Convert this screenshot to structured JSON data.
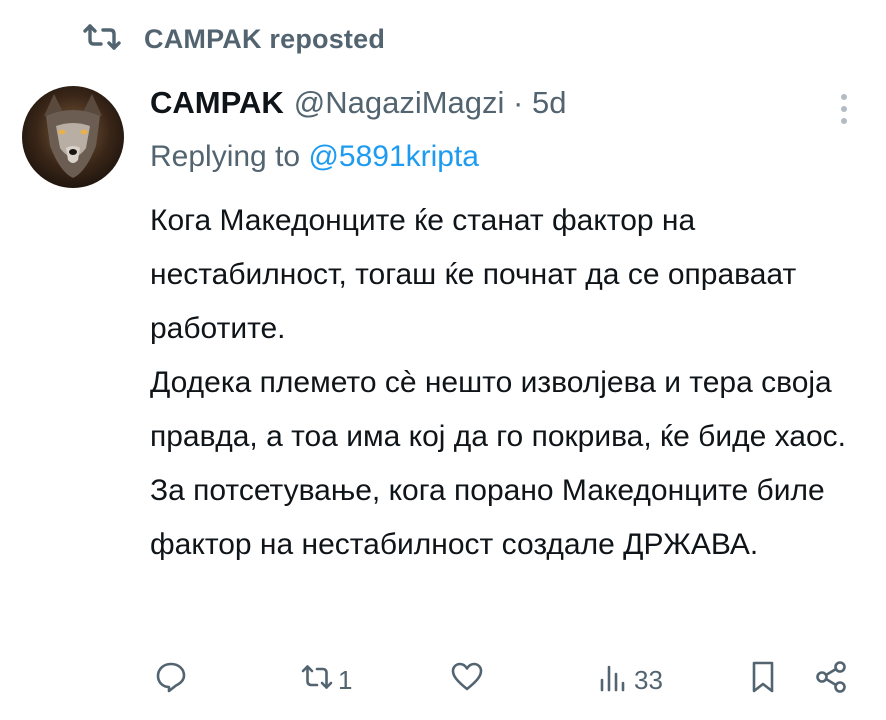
{
  "repost": {
    "icon": "repost-icon",
    "text": "CAMPAK reposted"
  },
  "tweet": {
    "avatar": "wolf-avatar",
    "display_name": "CAMPAK",
    "handle_time": "@NagaziMagzi · 5d",
    "replying_prefix": "Replying to",
    "replying_to": "@5891kripta",
    "lines": [
      "Кога Македонците ќе станат фактор на нестабилност, тогаш ќе почнат да се оправаат работите.",
      "Додека племето сѐ нешто изволјева и тера своја правда, а тоа има кој да го покрива, ќе биде хаос.",
      "За потсетување, кога порано Македонците биле фактор на нестабилност создале ДРЖАВА."
    ]
  },
  "actions": {
    "reply": {
      "icon": "reply-icon",
      "count": ""
    },
    "repost": {
      "icon": "repost-icon",
      "count": "1"
    },
    "like": {
      "icon": "heart-icon",
      "count": ""
    },
    "views": {
      "icon": "views-icon",
      "count": "33"
    },
    "bookmark": {
      "icon": "bookmark-icon"
    },
    "share": {
      "icon": "share-icon"
    }
  },
  "colors": {
    "text": "#0f1419",
    "secondary": "#536471",
    "link": "#1d9bf0"
  }
}
